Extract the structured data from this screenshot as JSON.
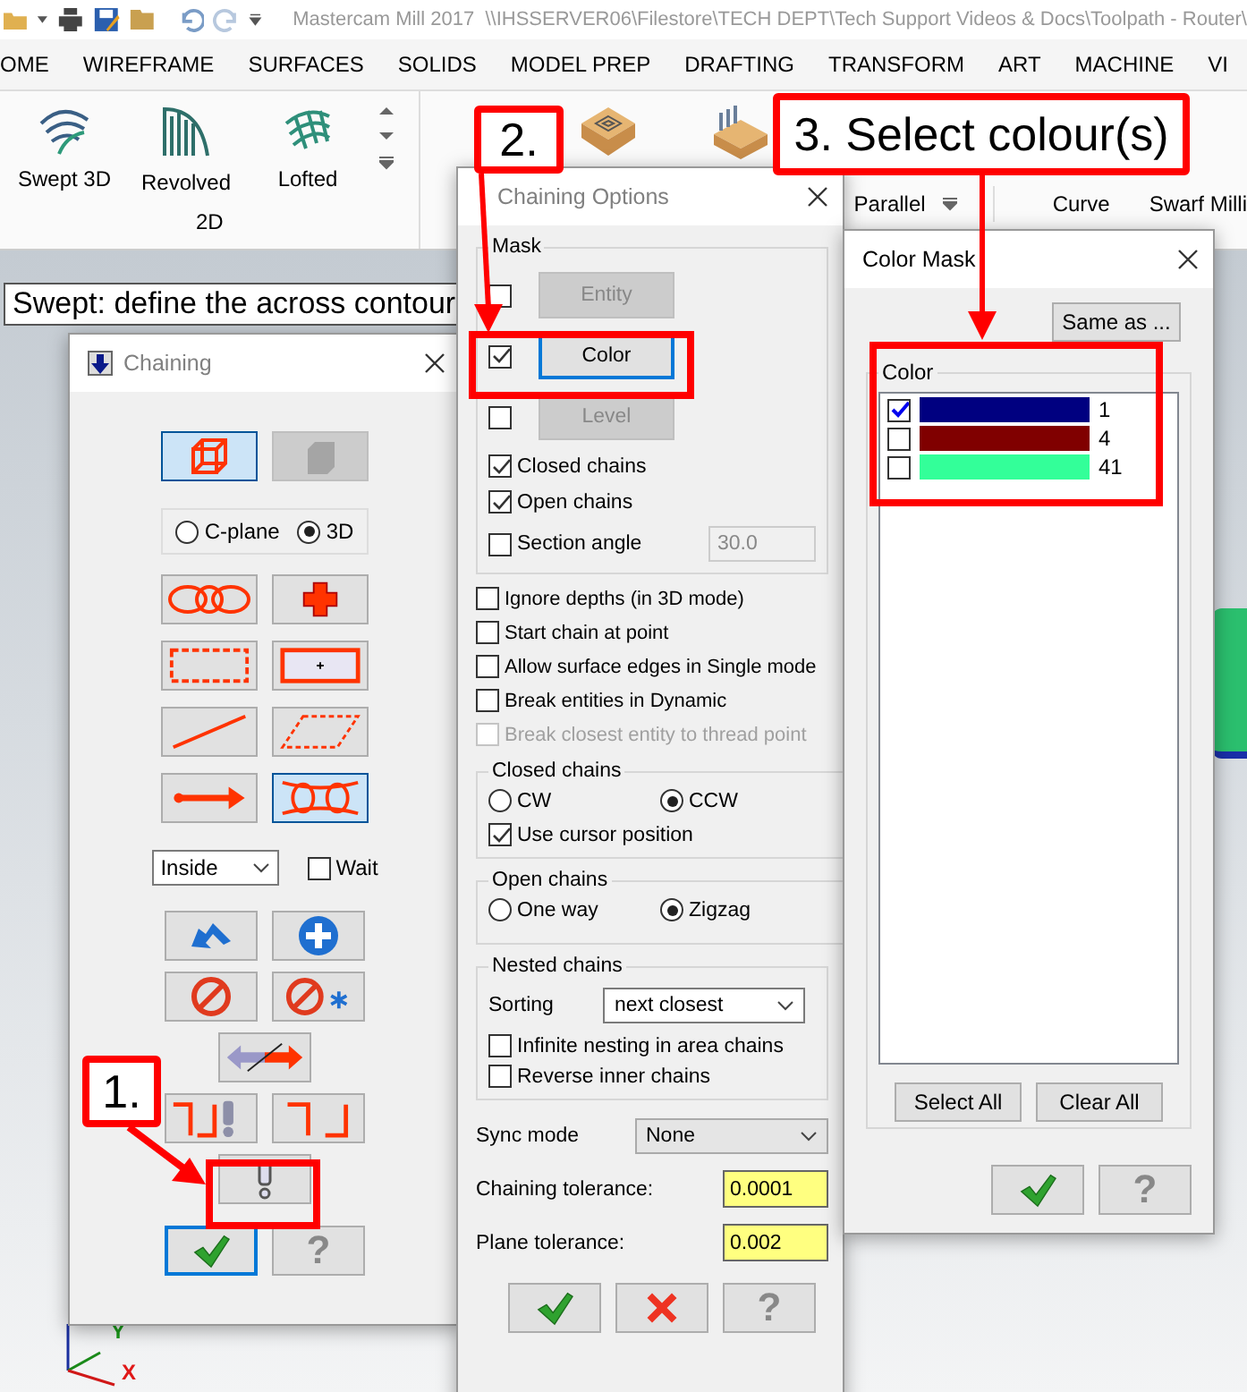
{
  "title_bar": {
    "app": "Mastercam Mill 2017",
    "path": "\\\\IHSSERVER06\\Filestore\\TECH DEPT\\Tech Support Videos & Docs\\Toolpath - Router\\"
  },
  "ribbon_tabs": [
    "OME",
    "WIREFRAME",
    "SURFACES",
    "SOLIDS",
    "MODEL PREP",
    "DRAFTING",
    "TRANSFORM",
    "ART",
    "MACHINE",
    "VI"
  ],
  "ribbon": {
    "group_label": "2D",
    "buttons": [
      {
        "kind": "swept",
        "label": "Swept 3D"
      },
      {
        "kind": "revolved",
        "label": "Revolved"
      },
      {
        "kind": "lofted",
        "label": "Lofted"
      }
    ],
    "right_labels": [
      "Parallel",
      "Curve",
      "Swarf Milli"
    ]
  },
  "prompt": "Swept: define the across contour",
  "chaining": {
    "title": "Chaining",
    "active": false,
    "mode_buttons": [
      {
        "kind": "wireframe",
        "selected": true,
        "disabled": false
      },
      {
        "kind": "solid",
        "selected": false,
        "disabled": true
      }
    ],
    "plane_options": [
      {
        "label": "C-plane",
        "selected": false
      },
      {
        "label": "3D",
        "selected": true
      }
    ],
    "method_buttons": [
      {
        "kind": "chain-loops",
        "selected": false
      },
      {
        "kind": "plus-cross",
        "selected": false
      },
      {
        "kind": "dashed-rect",
        "selected": false
      },
      {
        "kind": "framed-plus",
        "selected": false
      },
      {
        "kind": "line",
        "selected": false
      },
      {
        "kind": "dashed-parallelogram",
        "selected": false
      },
      {
        "kind": "arrow-line",
        "selected": false
      },
      {
        "kind": "partial-loops",
        "selected": true
      }
    ],
    "area_filter": "Inside",
    "wait": {
      "label": "Wait",
      "checked": false
    },
    "action_rows": [
      [
        {
          "kind": "back-arrow"
        },
        {
          "kind": "plus-circle"
        }
      ],
      [
        {
          "kind": "no-sign"
        },
        {
          "kind": "no-sign-star"
        }
      ],
      [
        {
          "kind": "swap-arrow"
        }
      ],
      [
        {
          "kind": "corners-alert"
        },
        {
          "kind": "corners"
        }
      ],
      [
        {
          "kind": "alert"
        }
      ],
      [
        {
          "kind": "ok",
          "focused": true
        },
        {
          "kind": "help",
          "label": "?",
          "focused": false
        }
      ]
    ]
  },
  "chaining_options": {
    "title": "Chaining Options",
    "active": false,
    "mask": {
      "label": "Mask",
      "rows": [
        {
          "button": "Entity",
          "checked": false,
          "disabled": true,
          "focused": false
        },
        {
          "button": "Color",
          "checked": true,
          "disabled": false,
          "focused": true
        },
        {
          "button": "Level",
          "checked": false,
          "disabled": true,
          "focused": false
        }
      ],
      "options": [
        {
          "label": "Closed chains",
          "checked": true
        },
        {
          "label": "Open chains",
          "checked": true
        },
        {
          "label": "Section angle",
          "checked": false,
          "value": "30.0"
        }
      ]
    },
    "options": [
      {
        "label": "Ignore depths (in 3D mode)",
        "checked": false,
        "disabled": false
      },
      {
        "label": "Start chain at point",
        "checked": false,
        "disabled": false
      },
      {
        "label": "Allow surface edges in Single mode",
        "checked": false,
        "disabled": false
      },
      {
        "label": "Break entities in Dynamic",
        "checked": false,
        "disabled": false
      },
      {
        "label": "Break closest entity to thread point",
        "checked": false,
        "disabled": true
      }
    ],
    "closed_chains": {
      "label": "Closed chains",
      "directions": [
        {
          "label": "CW",
          "selected": false
        },
        {
          "label": "CCW",
          "selected": true
        }
      ],
      "use_cursor": {
        "label": "Use cursor position",
        "checked": true
      }
    },
    "open_chains": {
      "label": "Open chains",
      "directions": [
        {
          "label": "One way",
          "selected": false
        },
        {
          "label": "Zigzag",
          "selected": true
        }
      ]
    },
    "nested_chains": {
      "label": "Nested chains",
      "sorting_label": "Sorting",
      "sorting": "next closest",
      "options": [
        {
          "label": "Infinite nesting in area chains",
          "checked": false
        },
        {
          "label": "Reverse inner chains",
          "checked": false
        }
      ]
    },
    "sync_mode": {
      "label": "Sync mode",
      "value": "None"
    },
    "tolerances": [
      {
        "label": "Chaining tolerance:",
        "value": "0.0001"
      },
      {
        "label": "Plane tolerance:",
        "value": "0.002"
      }
    ],
    "buttons": [
      {
        "kind": "ok"
      },
      {
        "kind": "cancel"
      },
      {
        "kind": "help",
        "label": "?"
      }
    ]
  },
  "color_mask": {
    "title": "Color Mask",
    "active": true,
    "same_as": "Same as ...",
    "group_label": "Color",
    "colors": [
      {
        "label": "1",
        "checked": true,
        "color": "#000080"
      },
      {
        "label": "4",
        "checked": false,
        "color": "#800000"
      },
      {
        "label": "41",
        "checked": false,
        "color": "#33ff99"
      }
    ],
    "buttons": [
      "Select All",
      "Clear All"
    ],
    "footer": [
      {
        "kind": "ok"
      },
      {
        "kind": "help",
        "label": "?"
      }
    ]
  },
  "annotations": [
    {
      "label": "1."
    },
    {
      "label": "2."
    },
    {
      "label": "3. Select colour(s)"
    }
  ],
  "view_axes": {
    "y": "Y",
    "x": "X"
  }
}
